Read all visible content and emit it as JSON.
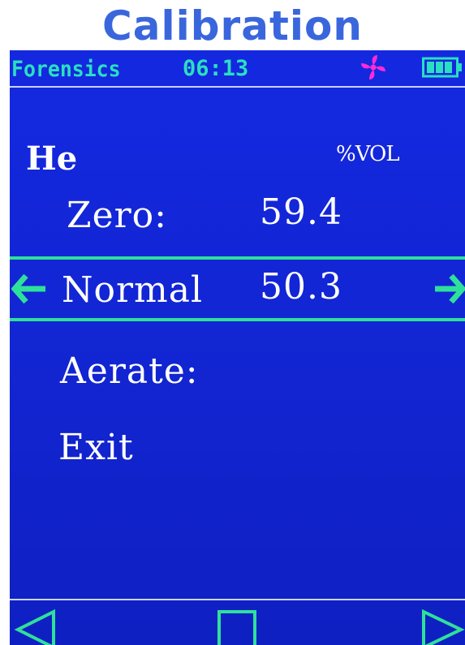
{
  "page_title": "Calibration",
  "status_bar": {
    "title": "Forensics",
    "time": "06:13",
    "fan_icon": "fan-icon",
    "battery_icon": "battery-icon",
    "accent_color": "#29e0c0",
    "fan_color": "#ff2bd6"
  },
  "gas": {
    "name": "He",
    "unit": "%VOL"
  },
  "menu": {
    "zero": {
      "label": "Zero:",
      "value": "59.4"
    },
    "normal": {
      "label": "Normal",
      "value": "50.3",
      "selected": true
    },
    "aerate": {
      "label": "Aerate:"
    },
    "exit": {
      "label": "Exit"
    }
  },
  "softkeys": {
    "left": "triangle-left-icon",
    "center": "square-icon",
    "right": "triangle-right-icon"
  },
  "colors": {
    "screen_background": "#1428e0",
    "highlight": "#2fe09a",
    "title": "#3a66dd"
  }
}
